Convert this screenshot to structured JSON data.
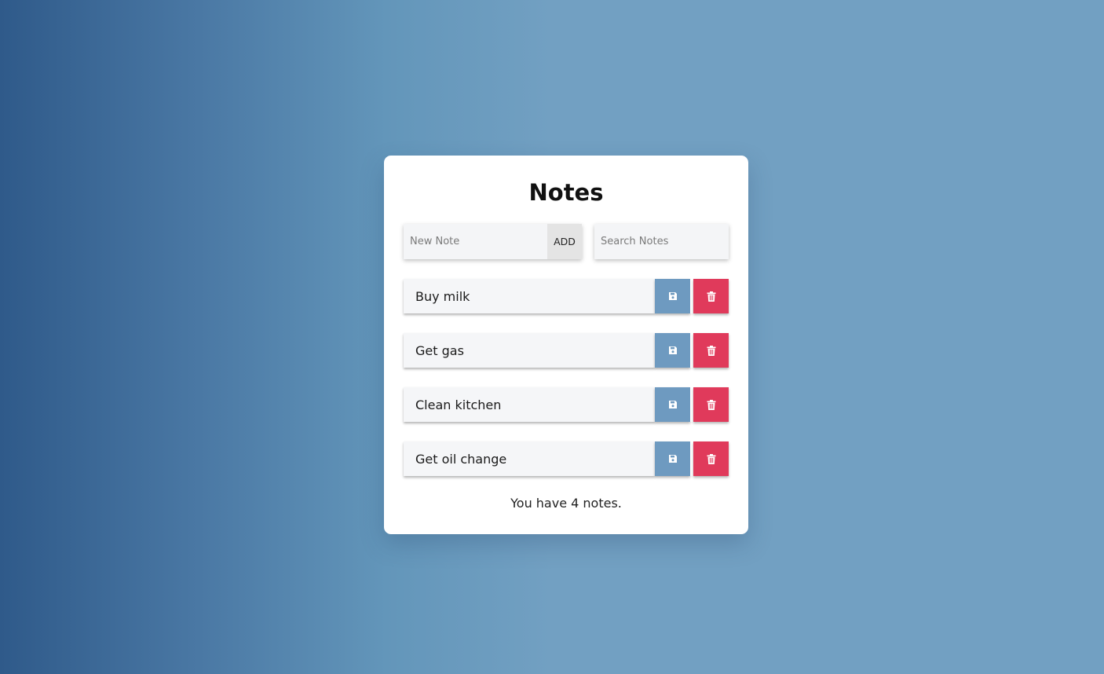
{
  "app": {
    "title": "Notes"
  },
  "new_note": {
    "placeholder": "New Note",
    "value": "",
    "add_label": "ADD"
  },
  "search": {
    "placeholder": "Search Notes",
    "value": ""
  },
  "notes": [
    {
      "text": "Buy milk",
      "save_icon": "floppy-disk-icon",
      "delete_icon": "trash-icon"
    },
    {
      "text": "Get gas",
      "save_icon": "floppy-disk-icon",
      "delete_icon": "trash-icon"
    },
    {
      "text": "Clean kitchen",
      "save_icon": "floppy-disk-icon",
      "delete_icon": "trash-icon"
    },
    {
      "text": "Get oil change",
      "save_icon": "floppy-disk-icon",
      "delete_icon": "trash-icon"
    }
  ],
  "footer": {
    "count_text": "You have 4 notes."
  },
  "colors": {
    "save": "#6e9ac0",
    "delete": "#e03a5b",
    "background_start": "#2f5a8a",
    "background_end": "#72a0c2"
  }
}
